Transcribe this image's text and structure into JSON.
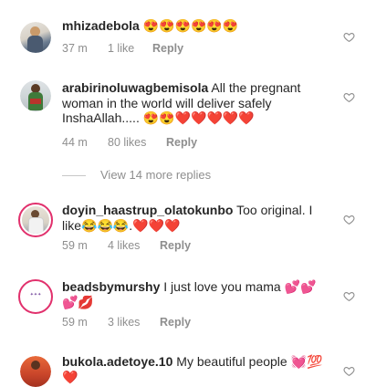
{
  "comments": [
    {
      "username": "mhizadebola",
      "body": " 😍😍😍😍😍😍",
      "time": "37 m",
      "likes": "1 like",
      "reply": "Reply"
    },
    {
      "username": "arabirinoluwagbemisola",
      "body": " All the pregnant woman in the world will deliver safely InshaAllah..... 😍😍❤️❤️❤️❤️❤️",
      "time": "44 m",
      "likes": "80 likes",
      "reply": "Reply"
    },
    {
      "username": "doyin_haastrup_olatokunbo",
      "body": " Too original. I like😂😂😂.❤️❤️❤️",
      "time": "59 m",
      "likes": "4 likes",
      "reply": "Reply"
    },
    {
      "username": "beadsbymurshy",
      "body": " I just love you mama 💕💕💕💋",
      "time": "59 m",
      "likes": "3 likes",
      "reply": "Reply"
    },
    {
      "username": "bukola.adetoye.10",
      "body": " My beautiful people 💓💯❤️",
      "time": "",
      "likes": "",
      "reply": ""
    }
  ],
  "view_more": "View 14 more replies",
  "icons": {
    "like": "heart-outline-icon",
    "heart_color": "#8e8e8e",
    "ring_color": "#e1306c"
  }
}
